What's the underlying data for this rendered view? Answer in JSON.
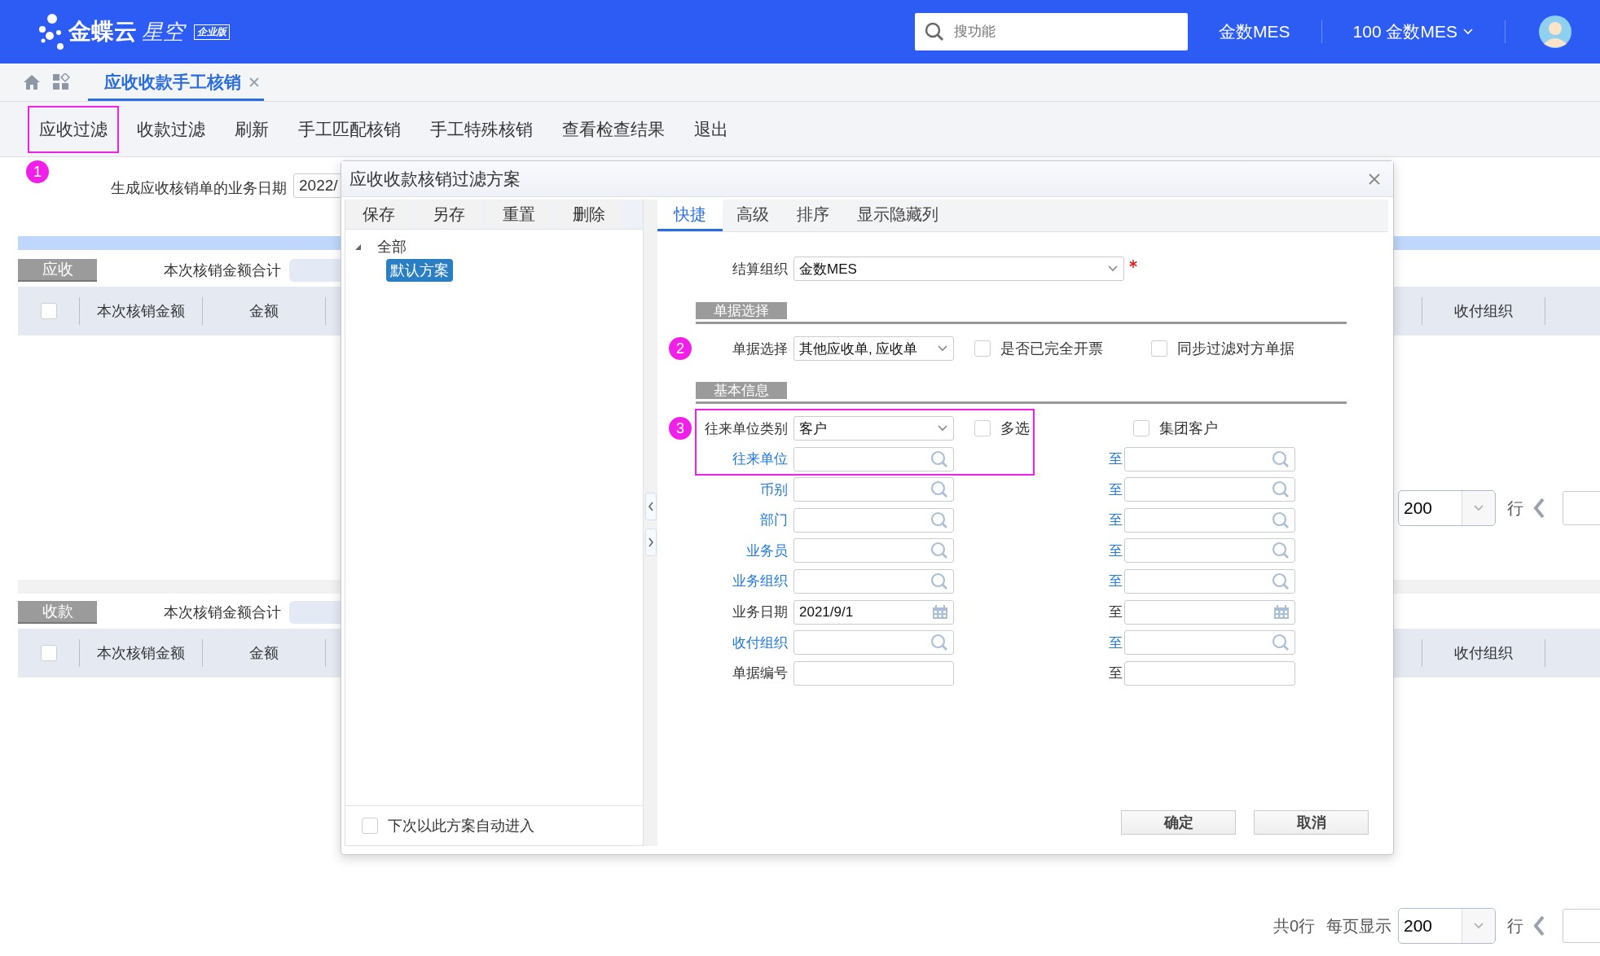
{
  "header": {
    "logo": {
      "name": "金蝶云",
      "suffix": "星空",
      "edition": "企业版"
    },
    "search": {
      "placeholder": "搜功能"
    },
    "org": "金数MES",
    "switcher": "100 金数MES"
  },
  "tabs": [
    {
      "label": "应收收款手工核销",
      "selected": true
    }
  ],
  "toolbar": [
    {
      "label": "应收过滤",
      "highlighted": true
    },
    {
      "label": "收款过滤",
      "highlighted": false
    },
    {
      "label": "刷新",
      "highlighted": false
    },
    {
      "label": "手工匹配核销",
      "highlighted": false
    },
    {
      "label": "手工特殊核销",
      "highlighted": false
    },
    {
      "label": "查看检查结果",
      "highlighted": false
    },
    {
      "label": "退出",
      "highlighted": false
    }
  ],
  "toolbar_badge": "1",
  "date_row": {
    "label": "生成应收核销单的业务日期",
    "value": "2022/"
  },
  "panels": [
    {
      "tab": "应收",
      "sum_label": "本次核销金额合计",
      "checked": false,
      "columns": [
        "本次核销金额",
        "金额"
      ],
      "right_columns": [
        "收付组织"
      ],
      "pagination": {
        "per_page": "200",
        "rows_unit": "行"
      }
    },
    {
      "tab": "收款",
      "sum_label": "本次核销金额合计",
      "checked": false,
      "columns": [
        "本次核销金额",
        "金额"
      ],
      "right_columns": [
        "收付组织"
      ],
      "pagination": {
        "total": "共0行",
        "per_page_label": "每页显示",
        "per_page": "200",
        "rows_unit": "行"
      }
    }
  ],
  "dialog": {
    "title": "应收收款核销过滤方案",
    "scheme_buttons": [
      "保存",
      "另存",
      "重置",
      "删除"
    ],
    "tree": [
      {
        "label": "全部",
        "expanded": true,
        "selected": false,
        "children": [
          {
            "label": "默认方案",
            "selected": true
          }
        ]
      }
    ],
    "auto_enter": {
      "label": "下次以此方案自动进入",
      "checked": false
    },
    "tabs": [
      {
        "label": "快捷",
        "selected": true
      },
      {
        "label": "高级",
        "selected": false
      },
      {
        "label": "排序",
        "selected": false
      },
      {
        "label": "显示隐藏列",
        "selected": false
      }
    ],
    "settle_org": {
      "label": "结算组织",
      "value": "金数MES",
      "required": true
    },
    "sections": [
      {
        "title": "单据选择",
        "rows": [
          {
            "label": "单据选择",
            "link": false,
            "kind": "select",
            "value": "其他应收单, 应收单",
            "badge": "2",
            "highlighted": false,
            "checks": [
              {
                "label": "是否已完全开票",
                "checked": false
              },
              {
                "label": "同步过滤对方单据",
                "checked": false
              }
            ]
          }
        ]
      },
      {
        "title": "基本信息",
        "rows": [
          {
            "label": "往来单位类别",
            "link": false,
            "kind": "select",
            "value": "客户",
            "badge": "3",
            "highlighted": true,
            "checks": [
              {
                "label": "多选",
                "checked": false
              },
              {
                "label": "集团客户",
                "checked": false
              }
            ]
          },
          {
            "label": "往来单位",
            "link": true,
            "kind": "lookup",
            "highlighted": true,
            "to": {
              "label": "至",
              "link": true,
              "kind": "lookup"
            }
          },
          {
            "label": "币别",
            "link": true,
            "kind": "lookup",
            "highlighted": false,
            "to": {
              "label": "至",
              "link": true,
              "kind": "lookup"
            }
          },
          {
            "label": "部门",
            "link": true,
            "kind": "lookup",
            "highlighted": false,
            "to": {
              "label": "至",
              "link": true,
              "kind": "lookup"
            }
          },
          {
            "label": "业务员",
            "link": true,
            "kind": "lookup",
            "highlighted": false,
            "to": {
              "label": "至",
              "link": true,
              "kind": "lookup"
            }
          },
          {
            "label": "业务组织",
            "link": true,
            "kind": "lookup",
            "highlighted": false,
            "to": {
              "label": "至",
              "link": true,
              "kind": "lookup"
            }
          },
          {
            "label": "业务日期",
            "link": false,
            "kind": "date",
            "value": "2021/9/1",
            "highlighted": false,
            "to": {
              "label": "至",
              "link": false,
              "kind": "date"
            }
          },
          {
            "label": "收付组织",
            "link": true,
            "kind": "lookup",
            "highlighted": false,
            "to": {
              "label": "至",
              "link": true,
              "kind": "lookup"
            }
          },
          {
            "label": "单据编号",
            "link": false,
            "kind": "text",
            "highlighted": false,
            "to": {
              "label": "至",
              "link": false,
              "kind": "text"
            }
          }
        ]
      }
    ],
    "buttons": [
      "确定",
      "取消"
    ]
  }
}
